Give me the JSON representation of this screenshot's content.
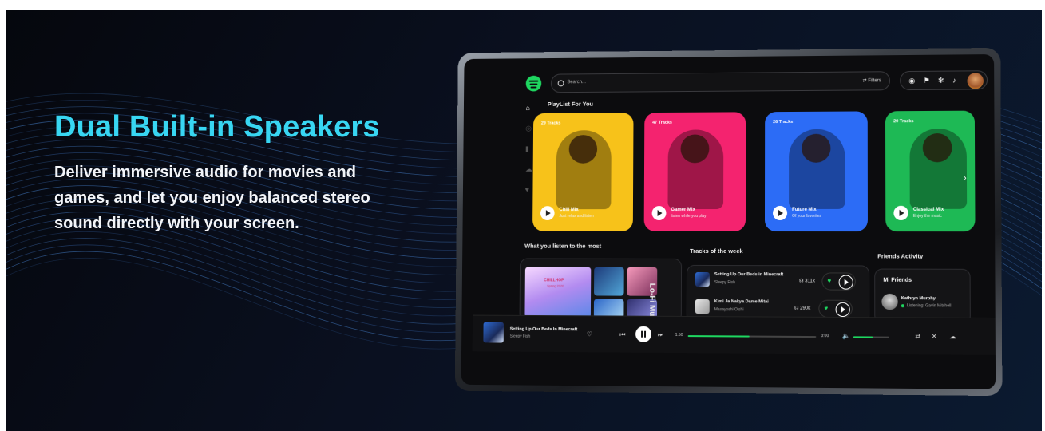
{
  "banner": {
    "headline": "Dual Built-in Speakers",
    "subcopy_lines": [
      "Deliver immersive audio for movies and",
      "games, and let you enjoy balanced stereo",
      "sound directly with your screen."
    ]
  },
  "app": {
    "search_placeholder": "Search...",
    "filters_label": "Filters",
    "top_icons": [
      "check-circle-icon",
      "flag-icon",
      "gear-icon",
      "bell-icon"
    ],
    "sidebar_icons": [
      "home-icon",
      "compass-icon",
      "mic-icon",
      "cloud-icon",
      "heart-icon"
    ],
    "sections": {
      "playlist_for_you": "PlayList For You",
      "listen_most": "What you listen to the most",
      "tracks_week": "Tracks of the week",
      "friends_activity": "Friends Activity"
    },
    "playlists": [
      {
        "tracks": "29 Tracks",
        "title": "Chill Mix",
        "subtitle": "Just relax and listen",
        "color": "#f7c21a"
      },
      {
        "tracks": "47 Tracks",
        "title": "Gamer Mix",
        "subtitle": "listen while you play",
        "color": "#f4236f"
      },
      {
        "tracks": "26 Tracks",
        "title": "Future Mix",
        "subtitle": "Of your favorites",
        "color": "#2c6cf6"
      },
      {
        "tracks": "20 Tracks",
        "title": "Classical Mix",
        "subtitle": "Enjoy the music",
        "color": "#1eb955"
      }
    ],
    "listen_most": {
      "album_title": "CHILLHOP",
      "album_sub": "Spring 2020",
      "vertical_label": "Lo-Fi Music"
    },
    "tracks_of_week": [
      {
        "title": "Setting Up Our Beds in Minecraft",
        "artist": "Sleepy Fish",
        "plays": "311k"
      },
      {
        "title": "Kimi Ja Nakya Dame Mitai",
        "artist": "Masayoshi Oishi",
        "plays": "290k"
      }
    ],
    "friends": {
      "title": "Mi Friends",
      "items": [
        {
          "name": "Kathryn Murphy",
          "status": "Listening: Gavin Mitchell"
        }
      ]
    },
    "player": {
      "title": "Setting Up Our Beds In Minecraft",
      "artist": "Sleepy Fish",
      "time_current": "1:50",
      "time_total": "3:00",
      "progress": 0.48,
      "volume": 0.55
    }
  },
  "colors": {
    "headline": "#38d6f2",
    "accent_green": "#1ed760"
  }
}
